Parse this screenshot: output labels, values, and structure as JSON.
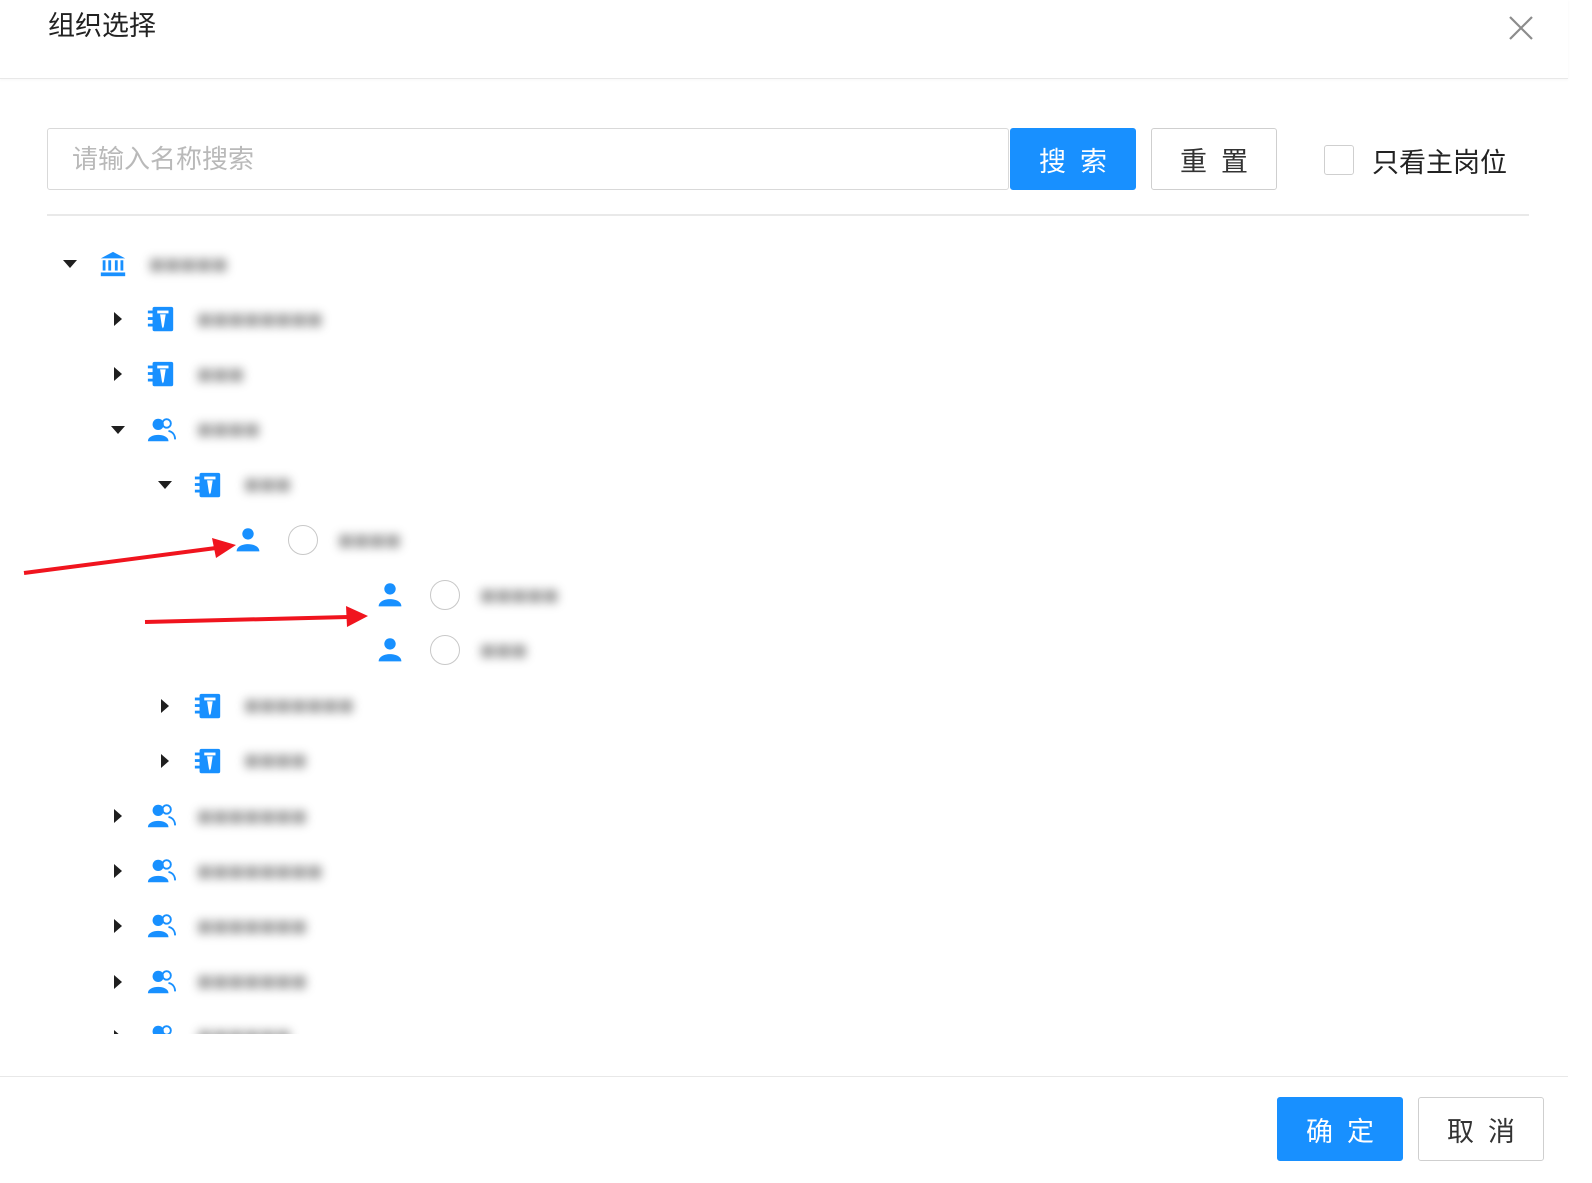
{
  "dialog": {
    "title": "组织选择",
    "close_icon": "close-icon"
  },
  "search": {
    "placeholder": "请输入名称搜索",
    "value": "",
    "search_label": "搜索",
    "reset_label": "重置",
    "only_main_post_label": "只看主岗位",
    "only_main_post_checked": false
  },
  "tree": {
    "nodes": [
      {
        "depth": 0,
        "expanded": true,
        "icon": "bank-icon",
        "label": "■■■■■"
      },
      {
        "depth": 1,
        "expanded": false,
        "icon": "department-icon",
        "label": "■■■■■■■■"
      },
      {
        "depth": 1,
        "expanded": false,
        "icon": "department-icon",
        "label": "■■■"
      },
      {
        "depth": 1,
        "expanded": true,
        "icon": "team-icon",
        "label": "■■■■"
      },
      {
        "depth": 2,
        "expanded": true,
        "icon": "department-icon",
        "label": "■■■"
      },
      {
        "depth": 3,
        "leaf": true,
        "icon": "user-icon",
        "label": "■■■■"
      },
      {
        "depth": 4,
        "leaf": true,
        "icon": "user-icon",
        "label": "■■■■■"
      },
      {
        "depth": 4,
        "leaf": true,
        "icon": "user-icon",
        "label": "■■■"
      },
      {
        "depth": 2,
        "expanded": false,
        "icon": "department-icon",
        "label": "■■■■■■■"
      },
      {
        "depth": 2,
        "expanded": false,
        "icon": "department-icon",
        "label": "■■■■"
      },
      {
        "depth": 1,
        "expanded": false,
        "icon": "team-icon",
        "label": "■■■■■■■"
      },
      {
        "depth": 1,
        "expanded": false,
        "icon": "team-icon",
        "label": "■■■■■■■■"
      },
      {
        "depth": 1,
        "expanded": false,
        "icon": "team-icon",
        "label": "■■■■■■■"
      },
      {
        "depth": 1,
        "expanded": false,
        "icon": "team-icon",
        "label": "■■■■■■■"
      },
      {
        "depth": 1,
        "expanded": false,
        "icon": "team-icon",
        "label": "■■■■■■"
      }
    ]
  },
  "footer": {
    "ok_label": "确定",
    "cancel_label": "取消"
  },
  "annotations": {
    "arrow_color": "#f0141e",
    "arrow_icon": "red-arrow-icon"
  },
  "colors": {
    "primary": "#1890ff",
    "icon_blue": "#1890ff",
    "border": "#d9d9d9"
  }
}
